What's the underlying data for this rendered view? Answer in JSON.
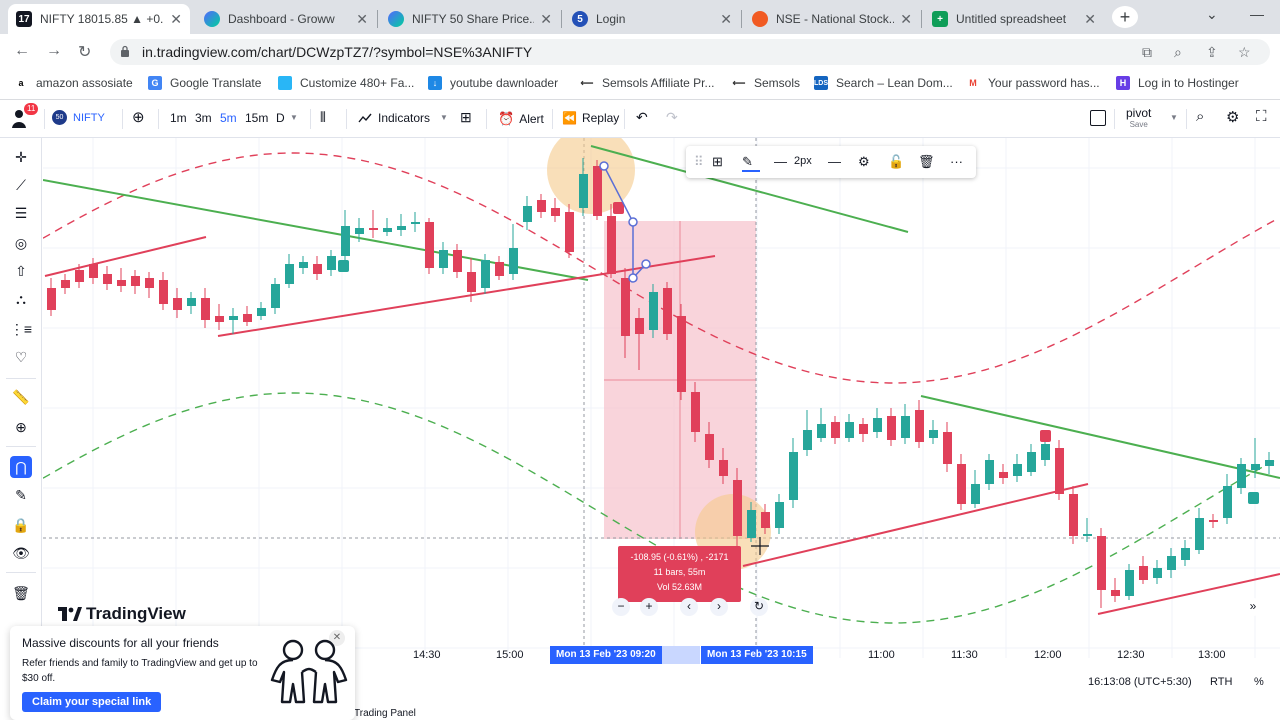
{
  "browser": {
    "tabs": [
      {
        "title": "NIFTY 18015.85 ▲ +0...",
        "favicon": "tv",
        "active": true
      },
      {
        "title": "Dashboard - Groww",
        "favicon": "groww",
        "active": false
      },
      {
        "title": "NIFTY 50 Share Price...",
        "favicon": "groww",
        "active": false
      },
      {
        "title": "Login",
        "favicon": "login",
        "active": false
      },
      {
        "title": "NSE - National Stock...",
        "favicon": "nse",
        "active": false
      },
      {
        "title": "Untitled spreadsheet",
        "favicon": "sheets",
        "active": false
      }
    ],
    "url": "in.tradingview.com/chart/DCWzpTZ7/?symbol=NSE%3ANIFTY",
    "bookmarks": [
      {
        "label": "amazon assosiate",
        "icon": "amazon-icon"
      },
      {
        "label": "Google Translate",
        "icon": "translate-icon"
      },
      {
        "label": "Customize 480+ Fa...",
        "icon": "customize-icon"
      },
      {
        "label": "youtube dawnloader",
        "icon": "download-icon"
      },
      {
        "label": "Semsols Affiliate Pr...",
        "icon": "semsols-icon"
      },
      {
        "label": "Semsols",
        "icon": "semsols-icon"
      },
      {
        "label": "Search – Lean Dom...",
        "icon": "lds-icon"
      },
      {
        "label": "Your password has...",
        "icon": "gmail-icon"
      },
      {
        "label": "Log in to Hostinger",
        "icon": "hostinger-icon"
      }
    ]
  },
  "toolbar": {
    "notif_count": "11",
    "symbol_badge": "50",
    "symbol": "NIFTY",
    "intervals": [
      "1m",
      "3m",
      "5m",
      "15m",
      "D"
    ],
    "active_interval": "5m",
    "indicators": "Indicators",
    "alert": "Alert",
    "replay": "Replay",
    "layout_name": "pivot",
    "layout_sub": "Save"
  },
  "drawing_toolbar": {
    "width_label": "2px"
  },
  "chart": {
    "time_labels": [
      "14:30",
      "15:00",
      "11:00",
      "11:30",
      "12:00",
      "12:30",
      "13:00"
    ],
    "range_start": "Mon 13 Feb '23   09:20",
    "range_end": "Mon 13 Feb '23   10:15",
    "measure_lines": [
      "-108.95 (-0.61%) , -2171",
      "11 bars, 55m",
      "Vol 52.63M"
    ],
    "clock": "16:13:08 (UTC+5:30)",
    "session": "RTH",
    "percent": "%",
    "logo_text": "TradingView"
  },
  "promo": {
    "heading": "Massive discounts for all your friends",
    "body": "Refer friends and family to TradingView and get up to $30 off.",
    "button": "Claim your special link"
  },
  "footer": {
    "trading_panel": "Trading Panel"
  },
  "colors": {
    "up": "#26a69a",
    "down": "#e0405a",
    "accent": "#2962ff"
  }
}
